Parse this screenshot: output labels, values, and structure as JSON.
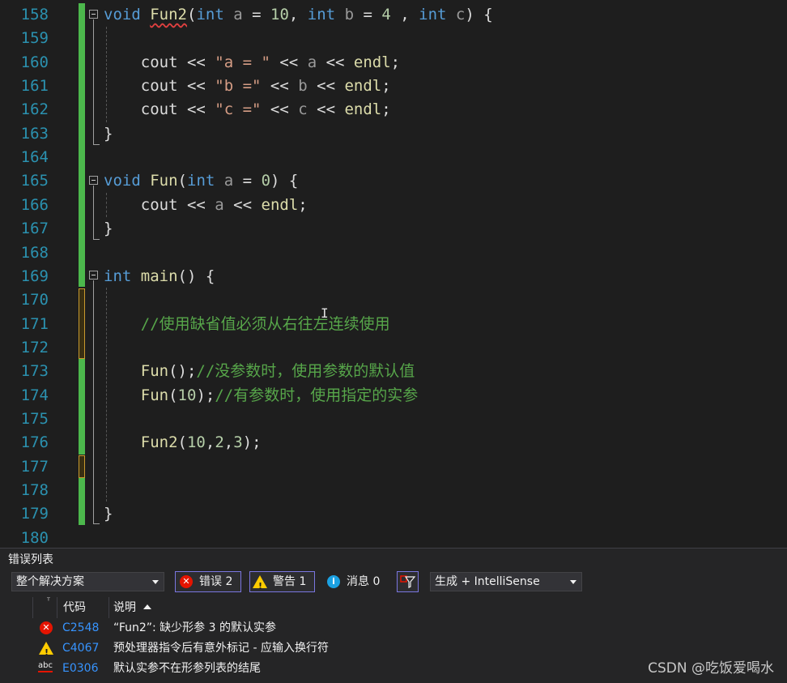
{
  "editor": {
    "lines": [
      {
        "n": "158",
        "html": "<span class=\"kw\">void</span> <span class=\"fn squig\">Fun2</span>(<span class=\"kw\">int</span> <span class=\"param\">a</span> = <span class=\"num\">10</span>, <span class=\"kw\">int</span> <span class=\"param\">b</span> = <span class=\"num\">4</span> , <span class=\"kw\">int</span> <span class=\"param\">c</span>) {"
      },
      {
        "n": "159",
        "html": ""
      },
      {
        "n": "160",
        "html": "    cout &lt;&lt; <span class=\"str\">\"a = \"</span> &lt;&lt; <span class=\"param\">a</span> &lt;&lt; <span class=\"fn\">endl</span>;"
      },
      {
        "n": "161",
        "html": "    cout &lt;&lt; <span class=\"str\">\"b =\"</span> &lt;&lt; <span class=\"param\">b</span> &lt;&lt; <span class=\"fn\">endl</span>;"
      },
      {
        "n": "162",
        "html": "    cout &lt;&lt; <span class=\"str\">\"c =\"</span> &lt;&lt; <span class=\"param\">c</span> &lt;&lt; <span class=\"fn\">endl</span>;"
      },
      {
        "n": "163",
        "html": "}"
      },
      {
        "n": "164",
        "html": ""
      },
      {
        "n": "165",
        "html": "<span class=\"kw\">void</span> <span class=\"fn\">Fun</span>(<span class=\"kw\">int</span> <span class=\"param\">a</span> = <span class=\"num\">0</span>) {"
      },
      {
        "n": "166",
        "html": "    cout &lt;&lt; <span class=\"param\">a</span> &lt;&lt; <span class=\"fn\">endl</span>;"
      },
      {
        "n": "167",
        "html": "}"
      },
      {
        "n": "168",
        "html": ""
      },
      {
        "n": "169",
        "html": "<span class=\"kw\">int</span> <span class=\"fn\">main</span>() {"
      },
      {
        "n": "170",
        "html": ""
      },
      {
        "n": "171",
        "html": "    <span class=\"cm\">//使用缺省值必须从右往左连续使用</span>"
      },
      {
        "n": "172",
        "html": ""
      },
      {
        "n": "173",
        "html": "    <span class=\"fn\">Fun</span>();<span class=\"cm\">//没参数时，使用参数的默认值</span>"
      },
      {
        "n": "174",
        "html": "    <span class=\"fn\">Fun</span>(<span class=\"num\">10</span>);<span class=\"cm\">//有参数时，使用指定的实参</span>"
      },
      {
        "n": "175",
        "html": ""
      },
      {
        "n": "176",
        "html": "    <span class=\"fn\">Fun2</span>(<span class=\"num\">10</span>,<span class=\"num\">2</span>,<span class=\"num\">3</span>);"
      },
      {
        "n": "177",
        "html": ""
      },
      {
        "n": "178",
        "html": ""
      },
      {
        "n": "179",
        "html": "}"
      },
      {
        "n": "180",
        "html": ""
      }
    ]
  },
  "error_list": {
    "title": "错误列表",
    "scope": "整个解决方案",
    "errors_label": "错误 2",
    "warnings_label": "警告 1",
    "messages_label": "消息 0",
    "build_filter": "生成 + IntelliSense",
    "col_code": "代码",
    "col_desc": "说明",
    "rows": [
      {
        "icon": "error-icon",
        "code": "C2548",
        "desc": "“Fun2”: 缺少形参 3 的默认实参"
      },
      {
        "icon": "warning-icon",
        "code": "C4067",
        "desc": "预处理器指令后有意外标记 - 应输入换行符"
      },
      {
        "icon": "intellisense-error-icon",
        "code": "E0306",
        "desc": "默认实参不在形参列表的结尾"
      }
    ]
  },
  "watermark": "CSDN @吃饭爱喝水",
  "colors": {
    "keyword": "#569cd6",
    "function": "#dcdcaa",
    "comment": "#57a64a",
    "line_number": "#2b91af"
  }
}
